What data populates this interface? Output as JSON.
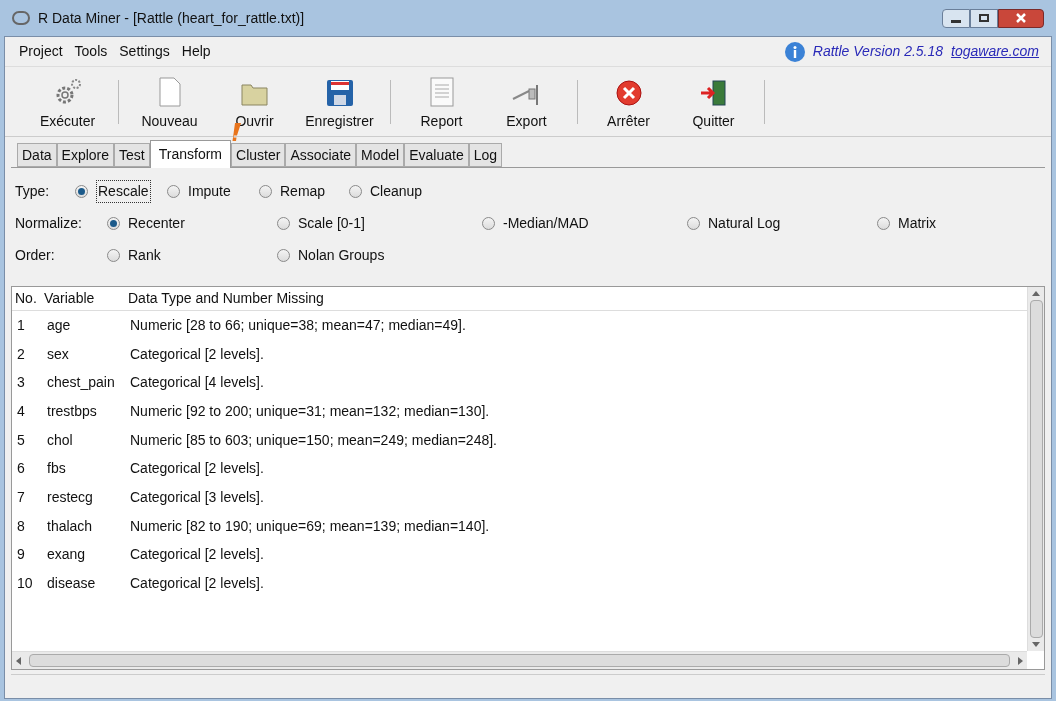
{
  "window": {
    "title": "R Data Miner - [Rattle (heart_for_rattle.txt)]"
  },
  "menu": [
    "Project",
    "Tools",
    "Settings",
    "Help"
  ],
  "version": {
    "text": "Rattle Version 2.5.18",
    "link": "togaware.com"
  },
  "toolbar": [
    {
      "label": "Exécuter",
      "kind": "execute"
    },
    {
      "label": "Nouveau",
      "kind": "new"
    },
    {
      "label": "Ouvrir",
      "kind": "open"
    },
    {
      "label": "Enregistrer",
      "kind": "save"
    },
    {
      "label": "Report",
      "kind": "report"
    },
    {
      "label": "Export",
      "kind": "export"
    },
    {
      "label": "Arrêter",
      "kind": "stop"
    },
    {
      "label": "Quitter",
      "kind": "quit"
    }
  ],
  "tabs": [
    {
      "label": "Data",
      "selected": false
    },
    {
      "label": "Explore",
      "selected": false
    },
    {
      "label": "Test",
      "selected": false
    },
    {
      "label": "Transform",
      "selected": true
    },
    {
      "label": "Cluster",
      "selected": false
    },
    {
      "label": "Associate",
      "selected": false
    },
    {
      "label": "Model",
      "selected": false
    },
    {
      "label": "Evaluate",
      "selected": false
    },
    {
      "label": "Log",
      "selected": false
    }
  ],
  "options": [
    {
      "label": "Type:",
      "choices": [
        {
          "label": "Rescale",
          "selected": true
        },
        {
          "label": "Impute",
          "selected": false
        },
        {
          "label": "Remap",
          "selected": false
        },
        {
          "label": "Cleanup",
          "selected": false
        }
      ]
    },
    {
      "label": "Normalize:",
      "choices": [
        {
          "label": "Recenter",
          "selected": true
        },
        {
          "label": "Scale [0-1]",
          "selected": false
        },
        {
          "label": "-Median/MAD",
          "selected": false
        },
        {
          "label": "Natural Log",
          "selected": false
        },
        {
          "label": "Matrix",
          "selected": false
        }
      ]
    },
    {
      "label": "Order:",
      "choices": [
        {
          "label": "Rank",
          "selected": false
        },
        {
          "label": "Nolan Groups",
          "selected": false
        }
      ]
    }
  ],
  "table": {
    "columns": [
      "No.",
      "Variable",
      "Data Type and Number Missing"
    ],
    "rows": [
      [
        "1",
        "age",
        "Numeric [28 to 66; unique=38; mean=47; median=49]."
      ],
      [
        "2",
        "sex",
        "Categorical [2 levels]."
      ],
      [
        "3",
        "chest_pain",
        "Categorical [4 levels]."
      ],
      [
        "4",
        "trestbps",
        "Numeric [92 to 200; unique=31; mean=132; median=130]."
      ],
      [
        "5",
        "chol",
        "Numeric [85 to 603; unique=150; mean=249; median=248]."
      ],
      [
        "6",
        "fbs",
        "Categorical [2 levels]."
      ],
      [
        "7",
        "restecg",
        "Categorical [3 levels]."
      ],
      [
        "8",
        "thalach",
        "Numeric [82 to 190; unique=69; mean=139; median=140]."
      ],
      [
        "9",
        "exang",
        "Categorical [2 levels]."
      ],
      [
        "10",
        "disease",
        "Categorical [2 levels]."
      ]
    ]
  }
}
